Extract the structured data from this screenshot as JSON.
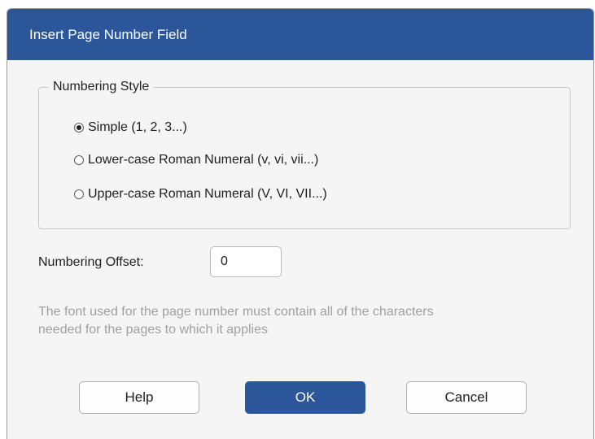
{
  "dialog": {
    "title": "Insert Page Number Field"
  },
  "numbering_style": {
    "legend": "Numbering Style",
    "selected_index": 0,
    "options": [
      {
        "label": "Simple  (1, 2, 3...)",
        "checked": true
      },
      {
        "label": "Lower-case Roman Numeral (v, vi, vii...)",
        "checked": false
      },
      {
        "label": "Upper-case Roman Numeral (V, VI, VII...)",
        "checked": false
      }
    ]
  },
  "offset": {
    "label": "Numbering Offset:",
    "value": "0"
  },
  "note": {
    "line1": "The font used for the page number must contain all of the characters",
    "line2": "needed for the pages to which it applies"
  },
  "buttons": {
    "help": "Help",
    "ok": "OK",
    "cancel": "Cancel"
  },
  "colors": {
    "accent": "#2b579a",
    "note_text": "#a0a0a0"
  }
}
